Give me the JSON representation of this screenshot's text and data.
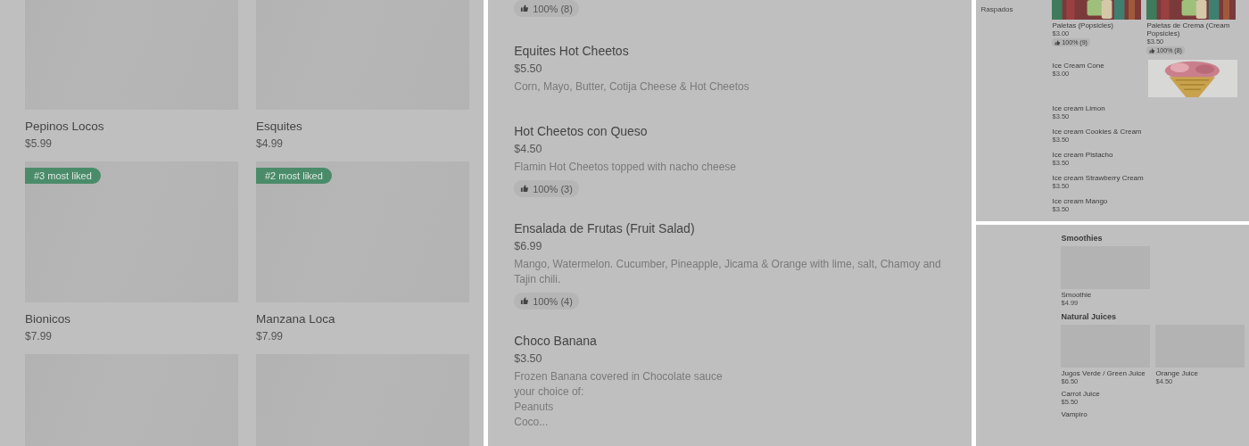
{
  "grid_panel": {
    "items": [
      {
        "kind": "product",
        "name": "Pepinos Locos",
        "price": "$5.99"
      },
      {
        "kind": "product",
        "name": "Esquites",
        "price": "$4.99"
      },
      {
        "kind": "product",
        "name": "Bionicos",
        "price": "$7.99",
        "badge": "#3 most liked"
      },
      {
        "kind": "product",
        "name": "Manzana Loca",
        "price": "$7.99",
        "badge": "#2 most liked"
      },
      {
        "kind": "image-only"
      },
      {
        "kind": "image-only"
      }
    ]
  },
  "list_panel": {
    "top_rating": "100% (8)",
    "items": [
      {
        "name": "Equites Hot Cheetos",
        "price": "$5.50",
        "description": "Corn, Mayo, Butter, Cotija Cheese & Hot Cheetos"
      },
      {
        "name": "Hot Cheetos con Queso",
        "price": "$4.50",
        "description": "Flamin Hot Cheetos topped with nacho cheese",
        "rating": "100% (3)"
      },
      {
        "name": "Ensalada de Frutas (Fruit Salad)",
        "price": "$6.99",
        "description": "Mango, Watermelon. Cucumber, Pineapple, Jicama & Orange with lime, salt, Chamoy and Tajin chili.",
        "rating": "100% (4)"
      },
      {
        "name": "Choco Banana",
        "price": "$3.50",
        "description": "Frozen Banana covered in Chocolate sauce\nyour choice of:\nPeanuts\nCoco..."
      }
    ]
  },
  "category_panel": {
    "sidebar_item": "Raspados",
    "cards": [
      {
        "name": "Paletas (Popsicles)",
        "price": "$3.00",
        "rating": "100% (9)"
      },
      {
        "name": "Paletas de Crema  (Cream Popsicles)",
        "price": "$3.50",
        "rating": "100% (8)"
      }
    ],
    "rows": [
      {
        "kind": "with-picture",
        "name": "Ice Cream Cone",
        "price": "$3.00"
      },
      {
        "kind": "plain",
        "name": "Ice cream Limon",
        "price": "$3.50"
      },
      {
        "kind": "plain",
        "name": "Ice cream Cookies & Cream",
        "price": "$3.50"
      },
      {
        "kind": "plain",
        "name": "Ice cream Pistacho",
        "price": "$3.50"
      },
      {
        "kind": "plain",
        "name": "Ice cream Strawberry Cream",
        "price": "$3.50"
      },
      {
        "kind": "plain",
        "name": "Ice cream Mango",
        "price": "$3.50"
      }
    ]
  },
  "juices_panel": {
    "sections": [
      {
        "title": "Smoothies",
        "items": [
          {
            "kind": "card",
            "name": "Smoothie",
            "price": "$4.99"
          }
        ]
      },
      {
        "title": "Natural Juices",
        "items": [
          {
            "kind": "card",
            "name": "Jugos Verde / Green Juice",
            "price": "$6.50"
          },
          {
            "kind": "card",
            "name": "Orange Juice",
            "price": "$4.50"
          },
          {
            "kind": "row",
            "name": "Carrot Juice",
            "price": "$5.50"
          },
          {
            "kind": "row",
            "name": "Vampiro"
          }
        ]
      }
    ]
  }
}
